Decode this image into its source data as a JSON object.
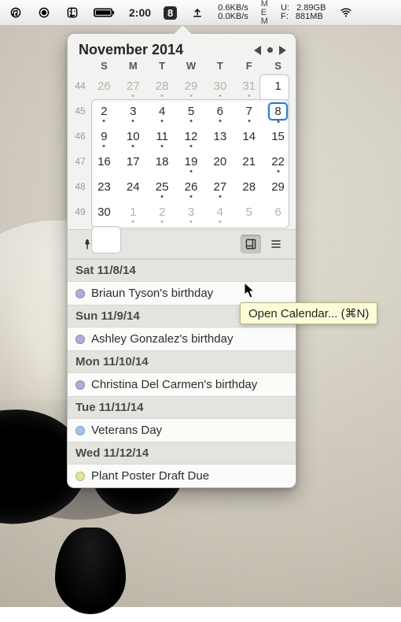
{
  "menubar": {
    "time": "2:00",
    "badge": "8",
    "net_down": "0.6KB/s",
    "net_up": "0.0KB/s",
    "mem_u_label": "U:",
    "mem_f_label": "F:",
    "mem_used": "2.89GB",
    "mem_free": "881MB"
  },
  "calendar": {
    "title": "November 2014",
    "dow": [
      "S",
      "M",
      "T",
      "W",
      "T",
      "F",
      "S"
    ],
    "rows": [
      {
        "wk": "44",
        "days": [
          {
            "n": "26",
            "out": true,
            "ev": false
          },
          {
            "n": "27",
            "out": true,
            "ev": true
          },
          {
            "n": "28",
            "out": true,
            "ev": true
          },
          {
            "n": "29",
            "out": true,
            "ev": true
          },
          {
            "n": "30",
            "out": true,
            "ev": true
          },
          {
            "n": "31",
            "out": true,
            "ev": true
          },
          {
            "n": "1",
            "out": false,
            "ev": false
          }
        ]
      },
      {
        "wk": "45",
        "days": [
          {
            "n": "2",
            "out": false,
            "ev": true
          },
          {
            "n": "3",
            "out": false,
            "ev": true
          },
          {
            "n": "4",
            "out": false,
            "ev": true
          },
          {
            "n": "5",
            "out": false,
            "ev": true
          },
          {
            "n": "6",
            "out": false,
            "ev": true
          },
          {
            "n": "7",
            "out": false,
            "ev": true
          },
          {
            "n": "8",
            "out": false,
            "ev": true,
            "today": true
          }
        ]
      },
      {
        "wk": "46",
        "days": [
          {
            "n": "9",
            "out": false,
            "ev": true
          },
          {
            "n": "10",
            "out": false,
            "ev": true
          },
          {
            "n": "11",
            "out": false,
            "ev": true
          },
          {
            "n": "12",
            "out": false,
            "ev": true
          },
          {
            "n": "13",
            "out": false,
            "ev": false
          },
          {
            "n": "14",
            "out": false,
            "ev": false
          },
          {
            "n": "15",
            "out": false,
            "ev": false
          }
        ]
      },
      {
        "wk": "47",
        "days": [
          {
            "n": "16",
            "out": false,
            "ev": false
          },
          {
            "n": "17",
            "out": false,
            "ev": false
          },
          {
            "n": "18",
            "out": false,
            "ev": false
          },
          {
            "n": "19",
            "out": false,
            "ev": true
          },
          {
            "n": "20",
            "out": false,
            "ev": false
          },
          {
            "n": "21",
            "out": false,
            "ev": false
          },
          {
            "n": "22",
            "out": false,
            "ev": true
          }
        ]
      },
      {
        "wk": "48",
        "days": [
          {
            "n": "23",
            "out": false,
            "ev": false
          },
          {
            "n": "24",
            "out": false,
            "ev": false
          },
          {
            "n": "25",
            "out": false,
            "ev": true
          },
          {
            "n": "26",
            "out": false,
            "ev": true
          },
          {
            "n": "27",
            "out": false,
            "ev": true
          },
          {
            "n": "28",
            "out": false,
            "ev": false
          },
          {
            "n": "29",
            "out": false,
            "ev": false
          }
        ]
      },
      {
        "wk": "49",
        "days": [
          {
            "n": "30",
            "out": false,
            "ev": false
          },
          {
            "n": "1",
            "out": true,
            "ev": true
          },
          {
            "n": "2",
            "out": true,
            "ev": true
          },
          {
            "n": "3",
            "out": true,
            "ev": true
          },
          {
            "n": "4",
            "out": true,
            "ev": true
          },
          {
            "n": "5",
            "out": true,
            "ev": false
          },
          {
            "n": "6",
            "out": true,
            "ev": false
          }
        ]
      }
    ]
  },
  "events": [
    {
      "header": "Sat 11/8/14",
      "items": [
        {
          "color": "#b7a9d6",
          "title": "Briaun Tyson's birthday"
        }
      ]
    },
    {
      "header": "Sun 11/9/14",
      "items": [
        {
          "color": "#b7a9d6",
          "title": "Ashley Gonzalez's birthday"
        }
      ]
    },
    {
      "header": "Mon 11/10/14",
      "items": [
        {
          "color": "#b7a9d6",
          "title": "Christina Del Carmen's birthday"
        }
      ]
    },
    {
      "header": "Tue 11/11/14",
      "items": [
        {
          "color": "#9fc4ee",
          "title": "Veterans Day"
        }
      ]
    },
    {
      "header": "Wed 11/12/14",
      "items": [
        {
          "color": "#e6e29a",
          "title": "Plant Poster Draft Due"
        }
      ]
    }
  ],
  "tooltip": "Open Calendar... (⌘N)"
}
